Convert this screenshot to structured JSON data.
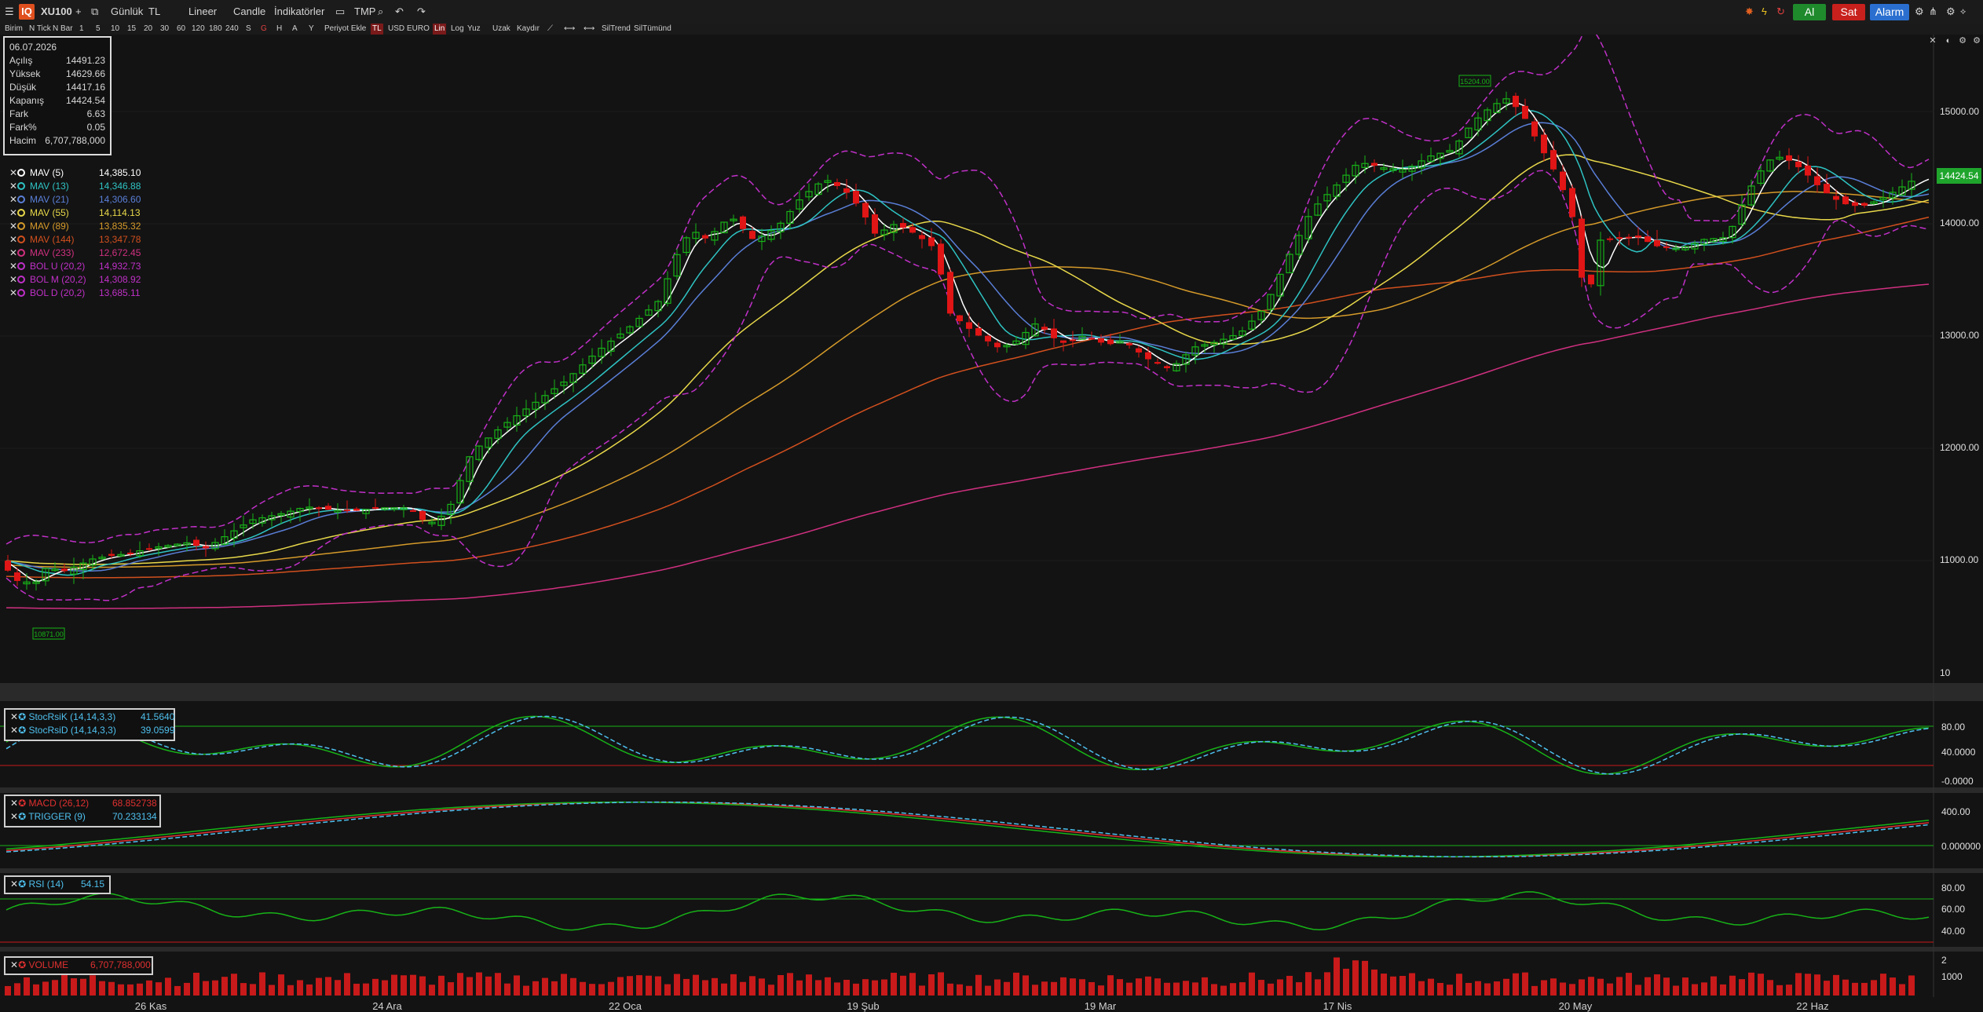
{
  "toolbar": {
    "symbol": "XU100",
    "period": "Günlük",
    "currency": "TL",
    "scale": "Lineer",
    "chart_type": "Candle",
    "indicators": "İndikatörler",
    "template": "TMP",
    "buy": "Al",
    "sell": "Sat",
    "alarm": "Alarm",
    "logo": "IQ"
  },
  "toolbar2": [
    "Birim",
    "N Tick",
    "N Bar",
    "1",
    "5",
    "10",
    "15",
    "20",
    "30",
    "60",
    "120",
    "180",
    "240",
    "S",
    "G",
    "H",
    "A",
    "Y",
    "Periyot Ekle",
    "TL",
    "USD",
    "EURO",
    "Lin",
    "Log",
    "Yuz",
    "Uzak",
    "Kaydır",
    "SilTrend",
    "SilTümünd"
  ],
  "info": {
    "date": "06.07.2026",
    "rows": [
      {
        "label": "Açılış",
        "value": "14491.23"
      },
      {
        "label": "Yüksek",
        "value": "14629.66"
      },
      {
        "label": "Düşük",
        "value": "14417.16"
      },
      {
        "label": "Kapanış",
        "value": "14424.54"
      },
      {
        "label": "Fark",
        "value": "6.63"
      },
      {
        "label": "Fark%",
        "value": "0.05"
      },
      {
        "label": "Hacim",
        "value": "6,707,788,000"
      }
    ]
  },
  "indicators": [
    {
      "name": "MAV (5)",
      "value": "14,385.10",
      "color": "#ffffff"
    },
    {
      "name": "MAV (13)",
      "value": "14,346.88",
      "color": "#2fc3c3"
    },
    {
      "name": "MAV (21)",
      "value": "14,306.60",
      "color": "#5a7fd8"
    },
    {
      "name": "MAV (55)",
      "value": "14,114.13",
      "color": "#e8d84a"
    },
    {
      "name": "MAV (89)",
      "value": "13,835.32",
      "color": "#d59a2a"
    },
    {
      "name": "MAV (144)",
      "value": "13,347.78",
      "color": "#d2501e"
    },
    {
      "name": "MAV (233)",
      "value": "12,672.45",
      "color": "#d03080"
    },
    {
      "name": "BOL U (20,2)",
      "value": "14,932.73",
      "color": "#c030c8"
    },
    {
      "name": "BOL M (20,2)",
      "value": "14,308.92",
      "color": "#c030c8"
    },
    {
      "name": "BOL D (20,2)",
      "value": "13,685.11",
      "color": "#c030c8"
    }
  ],
  "last_price": "14424.54",
  "price_axis": [
    "15000.00",
    "14000.00",
    "13000.00",
    "12000.00",
    "11000.00",
    "10"
  ],
  "stoch": {
    "k_name": "StocRsiK (14,14,3,3)",
    "k_value": "41.5640",
    "d_name": "StocRsiD (14,14,3,3)",
    "d_value": "39.0599",
    "axis": [
      "80.00",
      "40.0000",
      "-0.0000"
    ]
  },
  "macd": {
    "name": "MACD (26,12)",
    "value": "68.852738",
    "trig_name": "TRIGGER (9)",
    "trig_value": "70.233134",
    "axis": [
      "400.00",
      "0.000000"
    ]
  },
  "rsi": {
    "name": "RSI (14)",
    "value": "54.15",
    "axis": [
      "80.00",
      "60.00",
      "40.00"
    ]
  },
  "volume": {
    "name": "VOLUME",
    "value": "6,707,788,000",
    "axis": [
      "2",
      "1000"
    ]
  },
  "time_axis": [
    "26 Kas",
    "24 Ara",
    "22 Oca",
    "19 Şub",
    "19 Mar",
    "17 Nis",
    "20 May",
    "22 Haz"
  ],
  "chart_markers": {
    "high": "15204.00",
    "low": "10871.00"
  },
  "chart_data": {
    "type": "candlestick",
    "symbol": "XU100",
    "x": [
      "26 Kas",
      "24 Ara",
      "22 Oca",
      "19 Şub",
      "19 Mar",
      "17 Nis",
      "20 May",
      "22 Haz"
    ],
    "close_trend": [
      10900,
      11250,
      13800,
      14150,
      12850,
      14700,
      13800,
      14424.54
    ],
    "ylim": [
      10000,
      15500
    ],
    "colors": {
      "up": "#17b317",
      "down": "#e01515"
    }
  }
}
